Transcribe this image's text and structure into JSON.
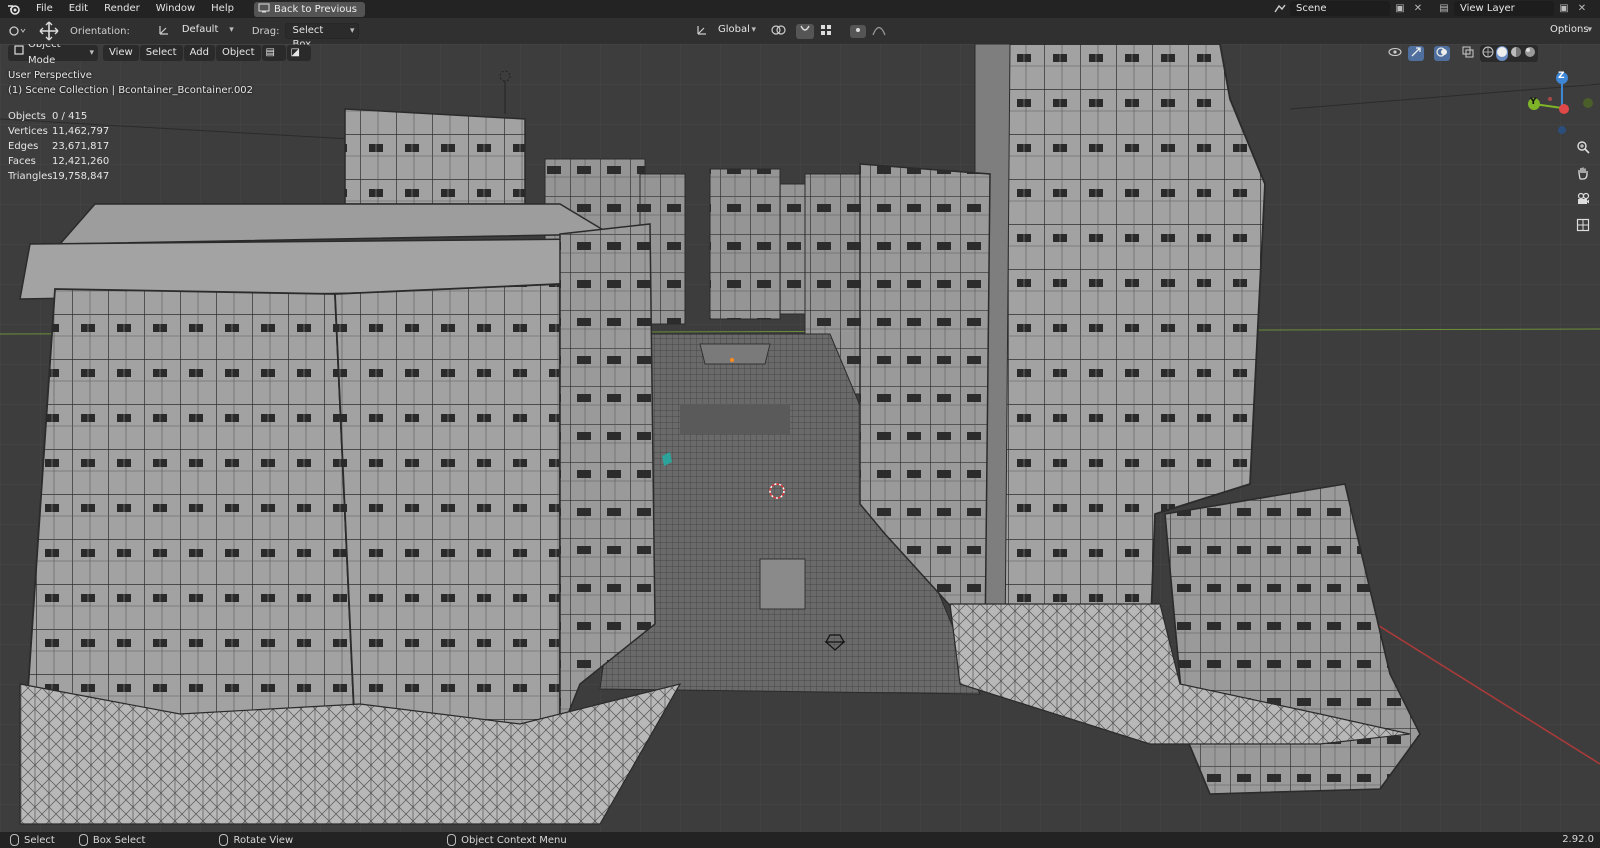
{
  "menu": {
    "items": [
      "File",
      "Edit",
      "Render",
      "Window",
      "Help"
    ],
    "back_label": "Back to Previous"
  },
  "scene": {
    "name": "Scene",
    "view_layer": "View Layer"
  },
  "toolheader": {
    "orientation_label": "Orientation:",
    "orientation_value": "Default",
    "drag_label": "Drag:",
    "drag_value": "Select Box",
    "transform_space": "Global",
    "options_label": "Options"
  },
  "viewport_header": {
    "mode": "Object Mode",
    "menus": [
      "View",
      "Select",
      "Add",
      "Object"
    ]
  },
  "overlay": {
    "perspective": "User Perspective",
    "collection": "(1) Scene Collection | Bcontainer_Bcontainer.002",
    "stats": [
      {
        "label": "Objects",
        "value": "0 / 415"
      },
      {
        "label": "Vertices",
        "value": "11,462,797"
      },
      {
        "label": "Edges",
        "value": "23,671,817"
      },
      {
        "label": "Faces",
        "value": "12,421,260"
      },
      {
        "label": "Triangles",
        "value": "19,758,847"
      }
    ]
  },
  "gizmo": {
    "z": "Z",
    "y": "Y"
  },
  "statusbar": {
    "select": "Select",
    "box_select": "Box Select",
    "rotate_view": "Rotate View",
    "context_menu": "Object Context Menu",
    "version": "2.92.0"
  },
  "colors": {
    "x_axis": "#a83a3a",
    "y_axis": "#7fb429",
    "z_axis": "#3e86d6",
    "mesh_fill": "#9a9a9a",
    "wire": "#2b2b2b"
  }
}
